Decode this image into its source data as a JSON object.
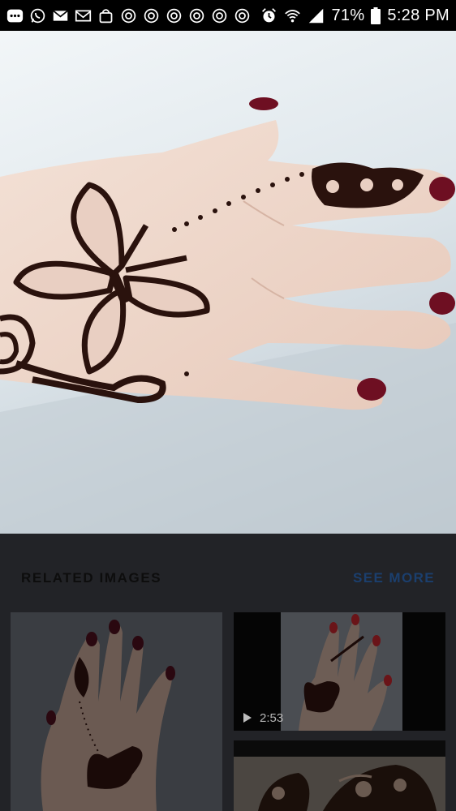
{
  "status_bar": {
    "left_icons": [
      "more-dots-icon",
      "whatsapp-icon",
      "mail-icon",
      "gmail-icon",
      "shopping-bag-icon",
      "chrome-icon",
      "chrome-icon",
      "chrome-icon",
      "chrome-icon",
      "chrome-icon",
      "chrome-icon"
    ],
    "right_icons": [
      "alarm-icon",
      "wifi-icon",
      "signal-icon"
    ],
    "battery": "71%",
    "time": "5:28 PM"
  },
  "related": {
    "title": "RELATED IMAGES",
    "see_more": "SEE MORE"
  },
  "video": {
    "duration": "2:53"
  },
  "colors": {
    "status_bg": "#000000",
    "overlay_bg": "#222327",
    "see_more": "#1b3f6e",
    "henna": "#2a120d",
    "nail": "#6e0f22"
  }
}
